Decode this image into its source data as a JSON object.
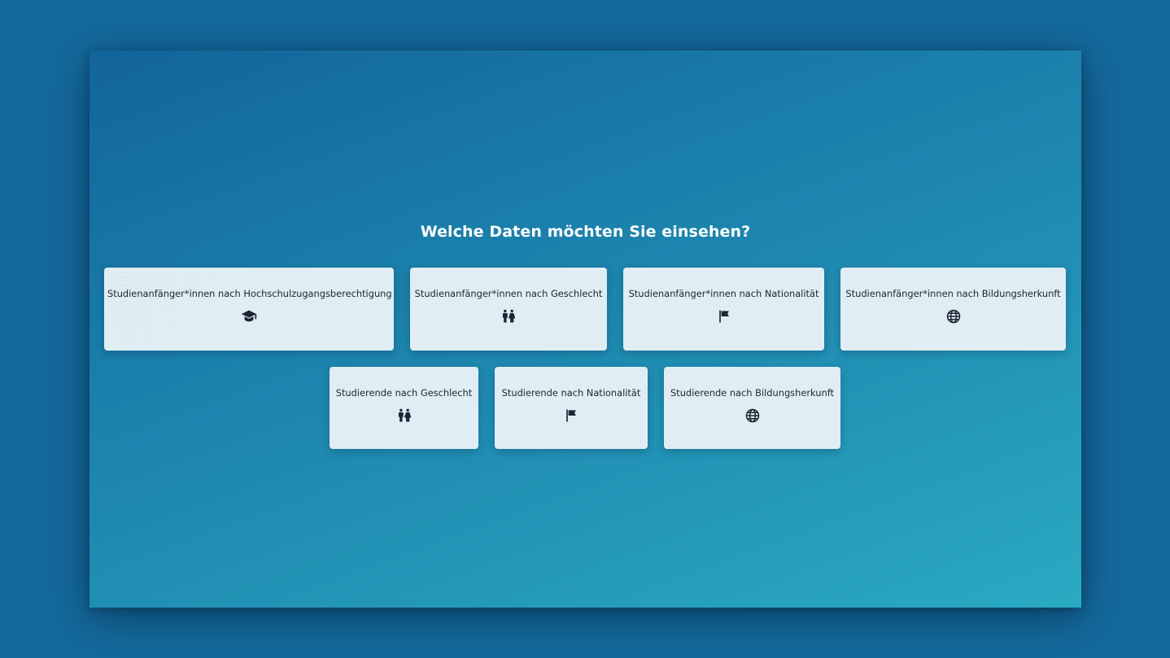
{
  "heading": "Welche Daten möchten Sie einsehen?",
  "cards": [
    {
      "label": "Studienanfänger*innen nach Hochschulzugangsberechtigung",
      "icon": "graduation-cap-icon"
    },
    {
      "label": "Studienanfänger*innen nach Geschlecht",
      "icon": "restroom-icon"
    },
    {
      "label": "Studienanfänger*innen nach Nationalität",
      "icon": "flag-icon"
    },
    {
      "label": "Studienanfänger*innen nach Bildungsherkunft",
      "icon": "globe-icon"
    },
    {
      "label": "Studierende nach Geschlecht",
      "icon": "restroom-icon"
    },
    {
      "label": "Studierende nach Nationalität",
      "icon": "flag-icon"
    },
    {
      "label": "Studierende nach Bildungsherkunft",
      "icon": "globe-icon"
    }
  ],
  "colors": {
    "page_background": "#146a9c",
    "gradient_start": "#12649a",
    "gradient_end": "#2aaac2",
    "card_background": "#e0edf4",
    "card_text": "#1c2530",
    "heading_text": "#ffffff"
  }
}
